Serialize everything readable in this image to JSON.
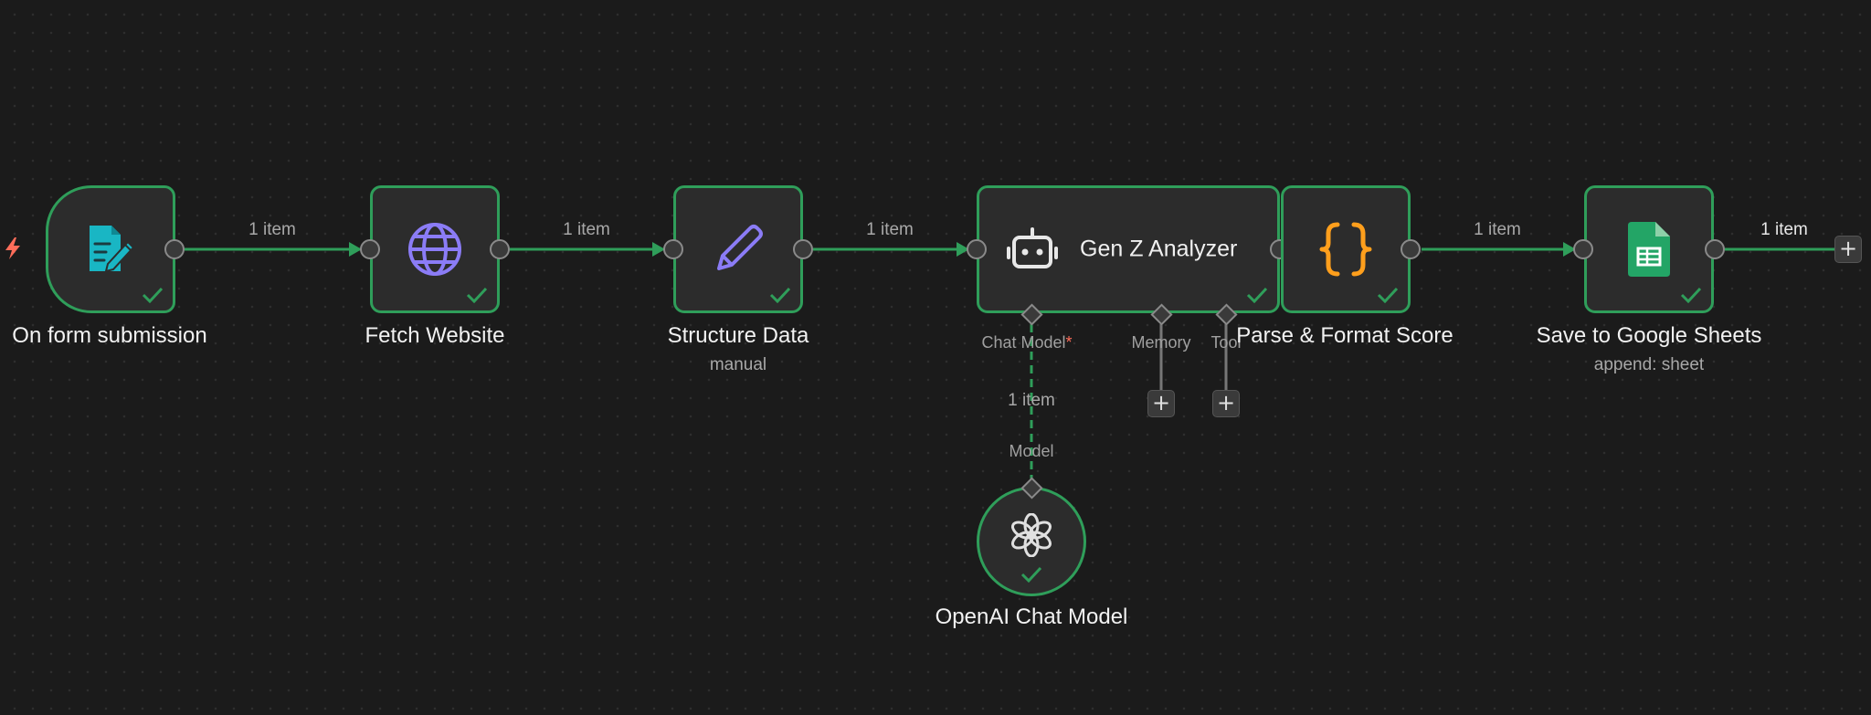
{
  "canvas": {
    "accent": "#2f9e5a",
    "background": "#1b1b1b"
  },
  "nodes": {
    "form": {
      "label": "On form submission",
      "icon": "form-edit-icon",
      "status": "success"
    },
    "fetch": {
      "label": "Fetch Website",
      "icon": "globe-icon",
      "status": "success"
    },
    "structure": {
      "label": "Structure Data",
      "subtitle": "manual",
      "icon": "pencil-icon",
      "status": "success"
    },
    "agent": {
      "label": "Gen Z Analyzer",
      "icon": "robot-icon",
      "status": "success",
      "sub_ports": {
        "chat_model": "Chat Model",
        "chat_model_required": "*",
        "memory": "Memory",
        "tool": "Tool"
      }
    },
    "parse": {
      "label": "Parse & Format Score",
      "icon": "code-braces-icon",
      "status": "success"
    },
    "sheets": {
      "label": "Save to Google Sheets",
      "subtitle": "append: sheet",
      "icon": "google-sheets-icon",
      "status": "success"
    },
    "openai": {
      "label": "OpenAI Chat Model",
      "icon": "openai-icon",
      "status": "success",
      "input_label": "Model"
    }
  },
  "edges": {
    "form_fetch": "1 item",
    "fetch_structure": "1 item",
    "structure_agent": "1 item",
    "parse_sheets": "1 item",
    "sheets_out": "1 item",
    "model_agent": "1 item"
  },
  "controls": {
    "plus": "+"
  }
}
